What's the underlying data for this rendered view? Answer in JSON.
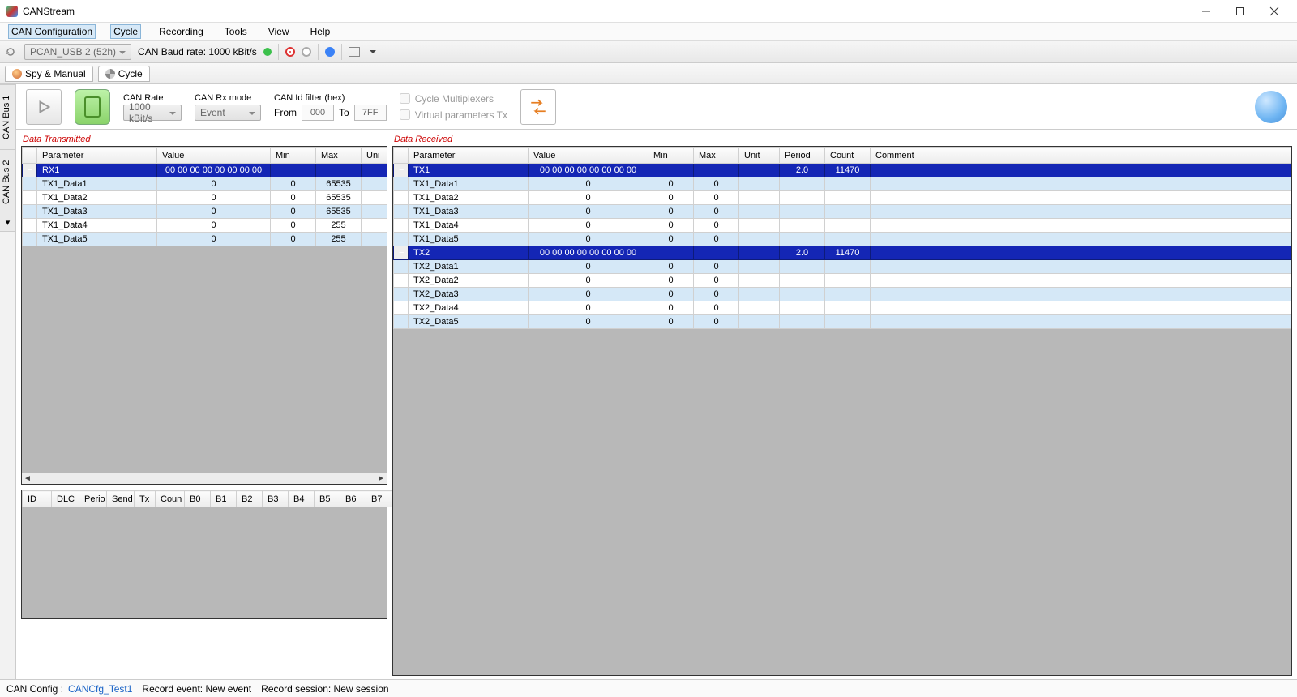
{
  "window": {
    "title": "CANStream"
  },
  "menu": {
    "items": [
      "CAN Configuration",
      "Cycle",
      "Recording",
      "Tools",
      "View",
      "Help"
    ],
    "active_index": 0
  },
  "toolbar": {
    "device": "PCAN_USB 2 (52h)",
    "baud_label": "CAN Baud rate: 1000 kBit/s"
  },
  "tabs": {
    "spy": "Spy & Manual",
    "cycle": "Cycle"
  },
  "side_tabs": [
    "CAN Bus 1",
    "CAN Bus 2"
  ],
  "controls": {
    "can_rate_label": "CAN Rate",
    "can_rate_value": "1000 kBit/s",
    "rx_mode_label": "CAN Rx mode",
    "rx_mode_value": "Event",
    "id_filter_label": "CAN Id filter (hex)",
    "from_label": "From",
    "from_value": "000",
    "to_label": "To",
    "to_value": "7FF",
    "chk_mux": "Cycle Multiplexers",
    "chk_vtx": "Virtual parameters Tx"
  },
  "tx": {
    "title": "Data Transmitted",
    "columns": [
      "",
      "Parameter",
      "Value",
      "Min",
      "Max",
      "Uni"
    ],
    "header_row": {
      "param": "RX1",
      "value": "00 00 00 00 00 00 00 00",
      "min": "",
      "max": "",
      "uni": ""
    },
    "rows": [
      {
        "param": "TX1_Data1",
        "value": "0",
        "min": "0",
        "max": "65535",
        "uni": ""
      },
      {
        "param": "TX1_Data2",
        "value": "0",
        "min": "0",
        "max": "65535",
        "uni": ""
      },
      {
        "param": "TX1_Data3",
        "value": "0",
        "min": "0",
        "max": "65535",
        "uni": ""
      },
      {
        "param": "TX1_Data4",
        "value": "0",
        "min": "0",
        "max": "255",
        "uni": ""
      },
      {
        "param": "TX1_Data5",
        "value": "0",
        "min": "0",
        "max": "255",
        "uni": ""
      }
    ],
    "raw_columns": [
      "ID",
      "DLC",
      "Perio",
      "Send",
      "Tx",
      "Coun",
      "B0",
      "B1",
      "B2",
      "B3",
      "B4",
      "B5",
      "B6",
      "B7"
    ]
  },
  "rx": {
    "title": "Data Received",
    "columns": [
      "",
      "Parameter",
      "Value",
      "Min",
      "Max",
      "Unit",
      "Period",
      "Count",
      "Comment"
    ],
    "groups": [
      {
        "param": "TX1",
        "value": "00 00 00 00 00 00 00 00",
        "period": "2.0",
        "count": "11470",
        "rows": [
          {
            "param": "TX1_Data1",
            "value": "0",
            "min": "0",
            "max": "0"
          },
          {
            "param": "TX1_Data2",
            "value": "0",
            "min": "0",
            "max": "0"
          },
          {
            "param": "TX1_Data3",
            "value": "0",
            "min": "0",
            "max": "0"
          },
          {
            "param": "TX1_Data4",
            "value": "0",
            "min": "0",
            "max": "0"
          },
          {
            "param": "TX1_Data5",
            "value": "0",
            "min": "0",
            "max": "0"
          }
        ]
      },
      {
        "param": "TX2",
        "value": "00 00 00 00 00 00 00 00",
        "period": "2.0",
        "count": "11470",
        "rows": [
          {
            "param": "TX2_Data1",
            "value": "0",
            "min": "0",
            "max": "0"
          },
          {
            "param": "TX2_Data2",
            "value": "0",
            "min": "0",
            "max": "0"
          },
          {
            "param": "TX2_Data3",
            "value": "0",
            "min": "0",
            "max": "0"
          },
          {
            "param": "TX2_Data4",
            "value": "0",
            "min": "0",
            "max": "0"
          },
          {
            "param": "TX2_Data5",
            "value": "0",
            "min": "0",
            "max": "0"
          }
        ]
      }
    ]
  },
  "status": {
    "config_label": "CAN Config :",
    "config_value": "CANCfg_Test1",
    "record_event": "Record event: New event",
    "record_session": "Record session: New session"
  }
}
